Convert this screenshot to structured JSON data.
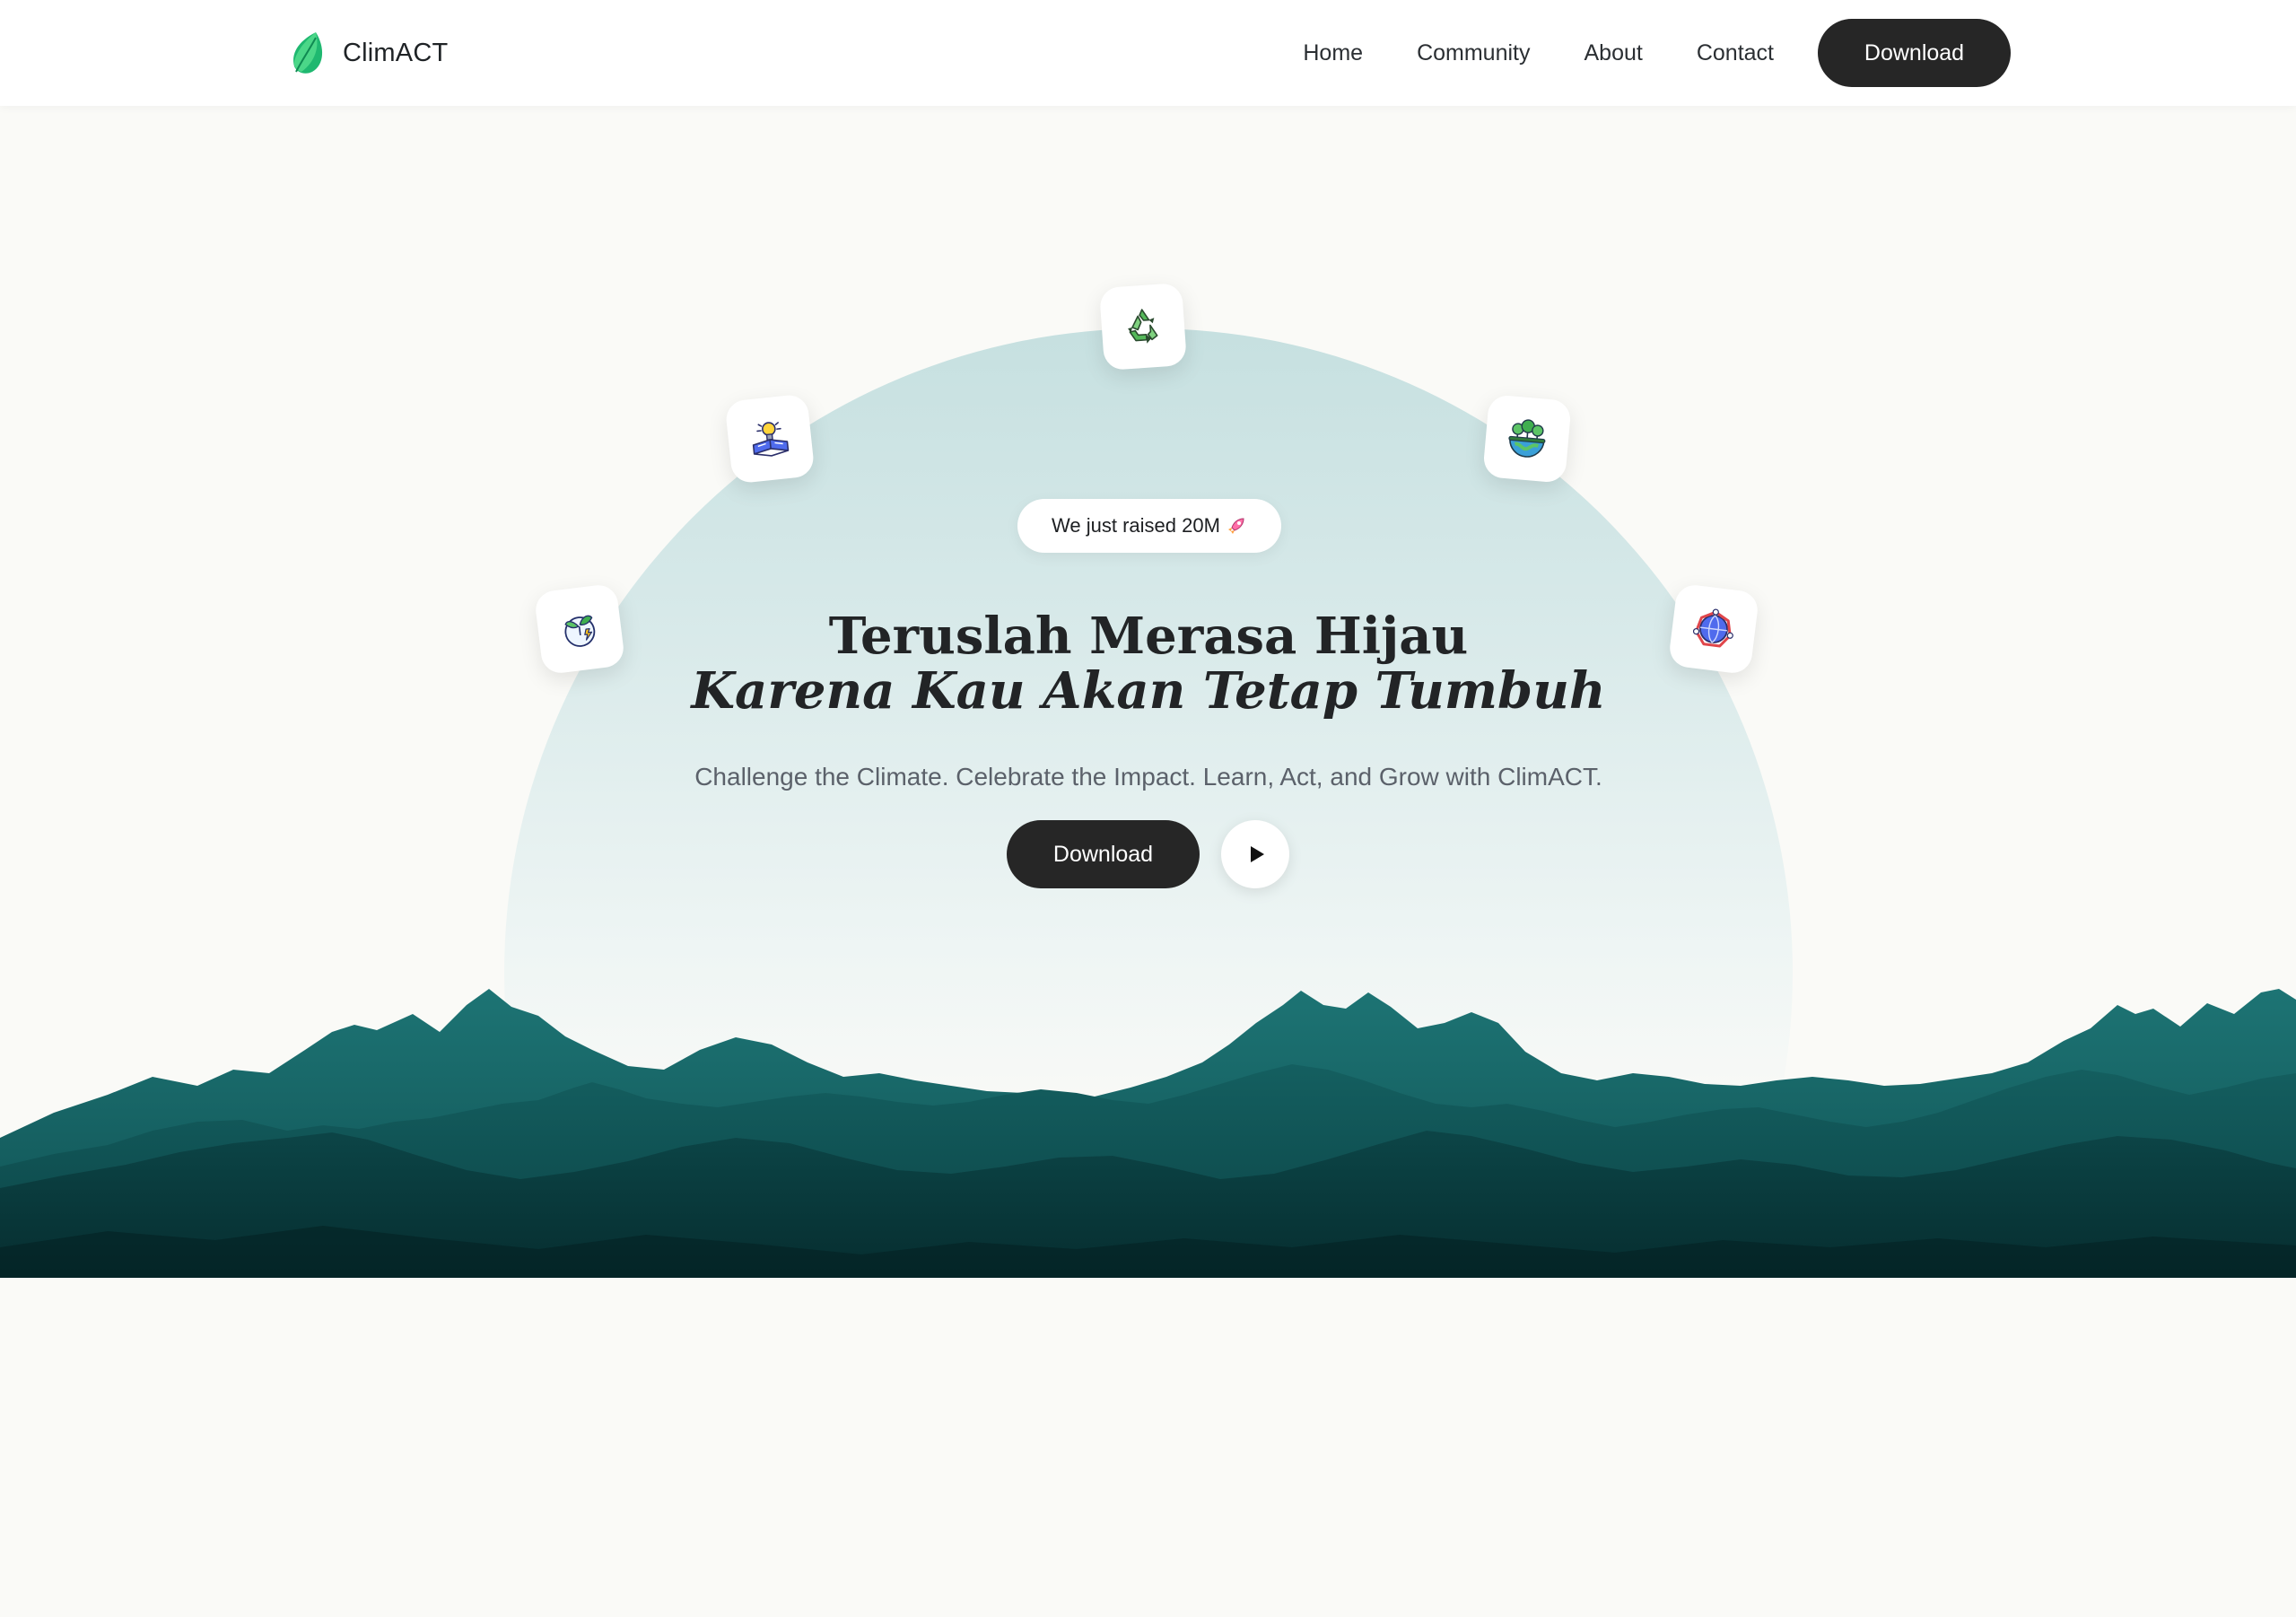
{
  "brand": {
    "name": "ClimACT",
    "logo_icon": "leaf-logo-icon"
  },
  "nav": {
    "links": [
      "Home",
      "Community",
      "About",
      "Contact"
    ],
    "download_label": "Download"
  },
  "hero": {
    "badge_text": "We just raised 20M",
    "badge_icon": "rocket-icon",
    "title_line1": "Teruslah Merasa Hijau",
    "title_line2": "Karena Kau Akan Tetap Tumbuh",
    "subtitle": "Challenge the Climate. Celebrate the Impact. Learn, Act, and Grow with ClimACT.",
    "download_label": "Download",
    "play_icon": "play-icon",
    "feature_icons": [
      "recycle-icon",
      "book-lightbulb-icon",
      "globe-plants-icon",
      "plant-globe-icon",
      "world-network-icon"
    ]
  },
  "colors": {
    "background": "#fafaf7",
    "button_dark": "#262626",
    "arch_teal": "#c6e0e0",
    "mountain_front": "#0a3a3c",
    "mountain_mid": "#0f5557",
    "mountain_back": "#17696a",
    "leaf_green": "#22c55e"
  }
}
